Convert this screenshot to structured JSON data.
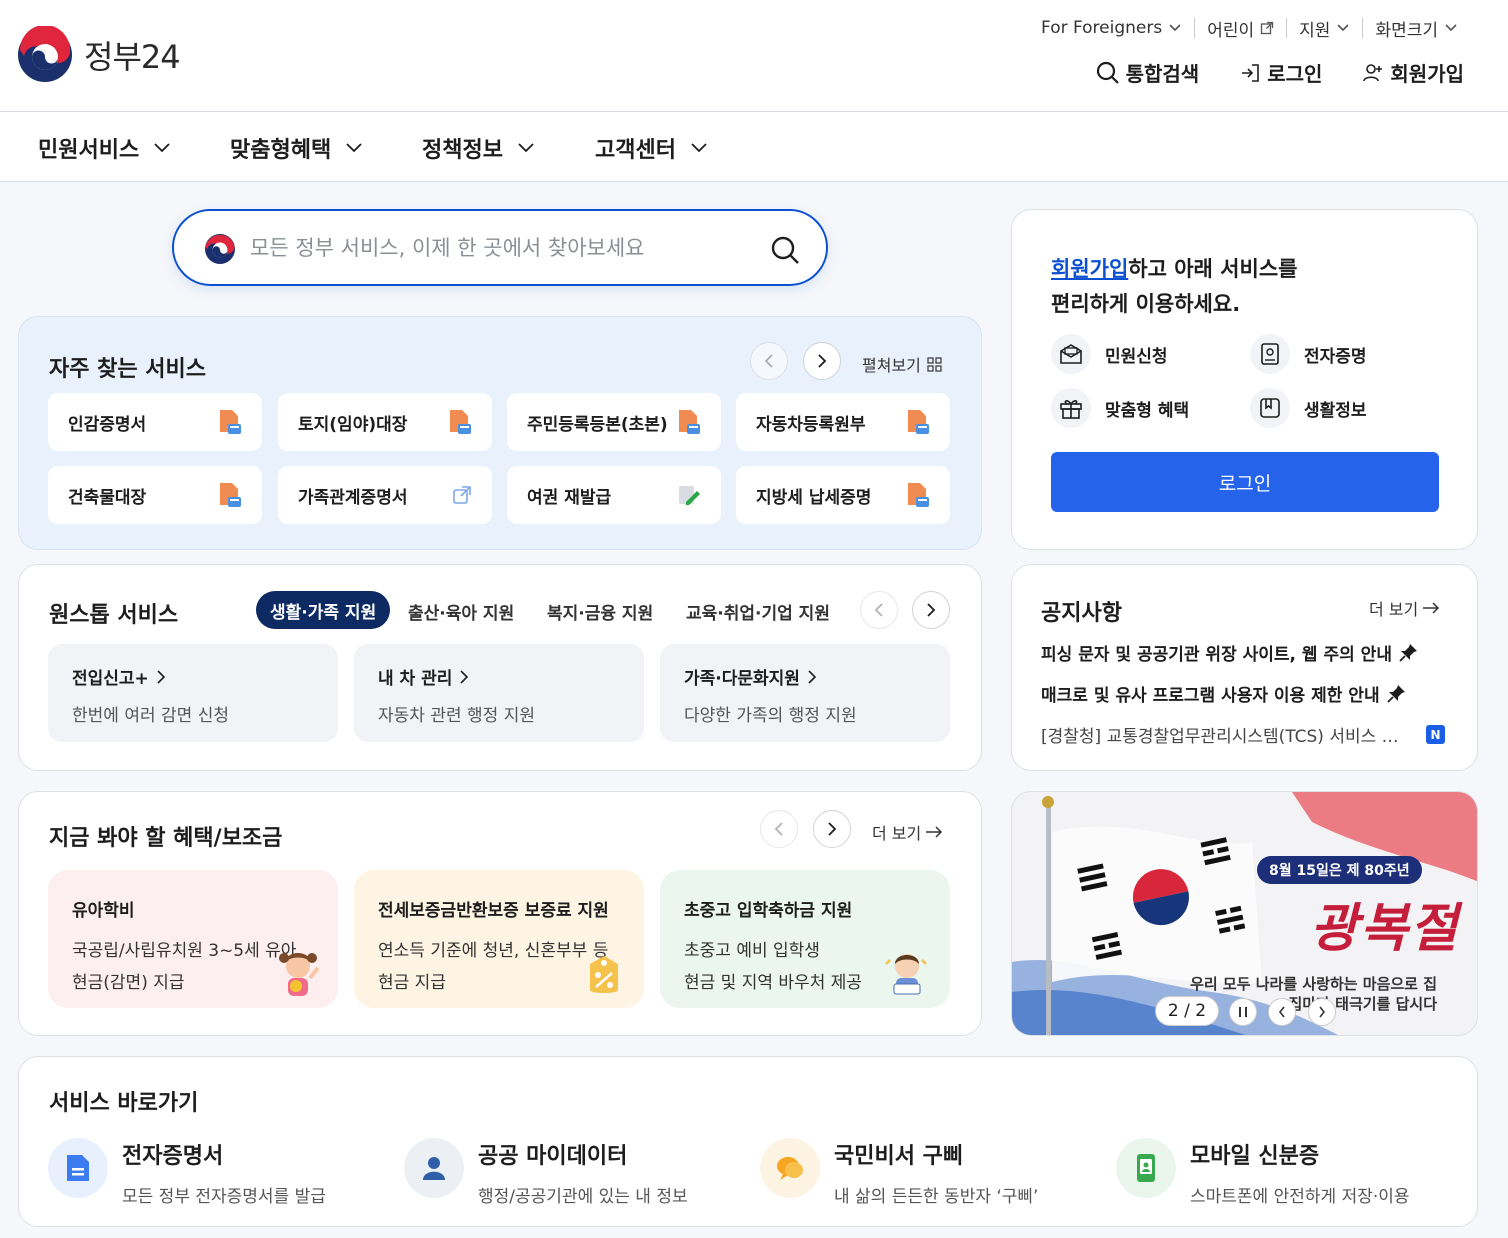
{
  "header": {
    "logo_text": "정부24",
    "utility": [
      {
        "label": "For Foreigners",
        "icon": "chevron-down-icon"
      },
      {
        "label": "어린이",
        "icon": "external-link-icon"
      },
      {
        "label": "지원",
        "icon": "chevron-down-icon"
      },
      {
        "label": "화면크기",
        "icon": "chevron-down-icon"
      }
    ],
    "account": {
      "search_label": "통합검색",
      "login_label": "로그인",
      "signup_label": "회원가입"
    }
  },
  "gnb": [
    "민원서비스",
    "맞춤형혜택",
    "정책정보",
    "고객센터"
  ],
  "search": {
    "placeholder": "모든 정부 서비스, 이제 한 곳에서 찾아보세요"
  },
  "frequent": {
    "title": "자주 찾는 서비스",
    "expand_label": "펼쳐보기",
    "items": [
      {
        "label": "인감증명서",
        "icon": "pdf-doc-icon"
      },
      {
        "label": "토지(임야)대장",
        "icon": "pdf-doc-icon"
      },
      {
        "label": "주민등록등본(초본)",
        "icon": "pdf-doc-icon"
      },
      {
        "label": "자동차등록원부",
        "icon": "pdf-doc-icon"
      },
      {
        "label": "건축물대장",
        "icon": "pdf-doc-icon"
      },
      {
        "label": "가족관계증명서",
        "icon": "external-link-icon"
      },
      {
        "label": "여권 재발급",
        "icon": "edit-doc-icon"
      },
      {
        "label": "지방세 납세증명",
        "icon": "pdf-doc-icon"
      }
    ]
  },
  "onestop": {
    "title": "원스톱 서비스",
    "tabs": [
      "생활·가족 지원",
      "출산·육아 지원",
      "복지·금융 지원",
      "교육·취업·기업 지원"
    ],
    "active_tab": "생활·가족 지원",
    "items": [
      {
        "title": "전입신고+",
        "desc": "한번에 여러 감면 신청"
      },
      {
        "title": "내 차 관리",
        "desc": "자동차 관련 행정 지원"
      },
      {
        "title": "가족·다문화지원",
        "desc": "다양한 가족의 행정 지원"
      }
    ]
  },
  "benefits": {
    "title": "지금 봐야 할 혜택/보조금",
    "more_label": "더 보기",
    "items": [
      {
        "title": "유아학비",
        "desc1": "국공립/사립유치원 3~5세 유아",
        "desc2": "현금(감면) 지급",
        "bg": "#fdeef0"
      },
      {
        "title": "전세보증금반환보증 보증료 지원",
        "desc1": "연소득 기준에 청년, 신혼부부 등",
        "desc2": "현금 지급",
        "bg": "#fdf4e3"
      },
      {
        "title": "초중고 입학축하금 지원",
        "desc1": "초중고 예비 입학생",
        "desc2": "현금 및 지역 바우처 제공",
        "bg": "#ebf6ee"
      }
    ]
  },
  "member": {
    "line1_link": "회원가입",
    "line1_rest": "하고 아래 서비스를",
    "line2": "편리하게 이용하세요.",
    "features": [
      {
        "label": "민원신청",
        "icon": "mail-icon"
      },
      {
        "label": "전자증명",
        "icon": "certificate-icon"
      },
      {
        "label": "맞춤형 혜택",
        "icon": "gift-icon"
      },
      {
        "label": "생활정보",
        "icon": "bookmark-icon"
      }
    ],
    "login_button": "로그인"
  },
  "notice": {
    "title": "공지사항",
    "more_label": "더 보기",
    "items": [
      {
        "text": "피싱 문자 및 공공기관 위장 사이트, 웹 주의 안내",
        "pinned": true
      },
      {
        "text": "매크로 및 유사 프로그램 사용자 이용 제한 안내",
        "pinned": true
      },
      {
        "text": "[경찰청] 교통경찰업무관리시스템(TCS) 서비스 …",
        "pinned": false,
        "badge": "N"
      }
    ]
  },
  "banner": {
    "pill": "8월 15일은 제 80주년",
    "headline": "광복절",
    "sub": "우리 모두 나라를 사랑하는 마음으로 집집마다 태극기를 답시다",
    "page": "2 / 2"
  },
  "quicklinks": {
    "title": "서비스 바로가기",
    "items": [
      {
        "title": "전자증명서",
        "desc": "모든 정부 전자증명서를 발급",
        "icon": "document-icon",
        "bg": "#e8f0fe"
      },
      {
        "title": "공공 마이데이터",
        "desc": "행정/공공기관에 있는 내 정보",
        "icon": "person-icon",
        "bg": "#eceff3"
      },
      {
        "title": "국민비서 구삐",
        "desc": "내 삶의 든든한 동반자 ‘구삐’",
        "icon": "chat-bubble-icon",
        "bg": "#fdf3e3"
      },
      {
        "title": "모바일 신분증",
        "desc": "스마트폰에 안전하게 저장·이용",
        "icon": "mobile-id-icon",
        "bg": "#eaf6ec"
      }
    ]
  },
  "colors": {
    "brand_blue": "#0b50d0",
    "button_blue": "#2563eb",
    "accent_red": "#e0263c",
    "navy": "#1a2f6b"
  }
}
